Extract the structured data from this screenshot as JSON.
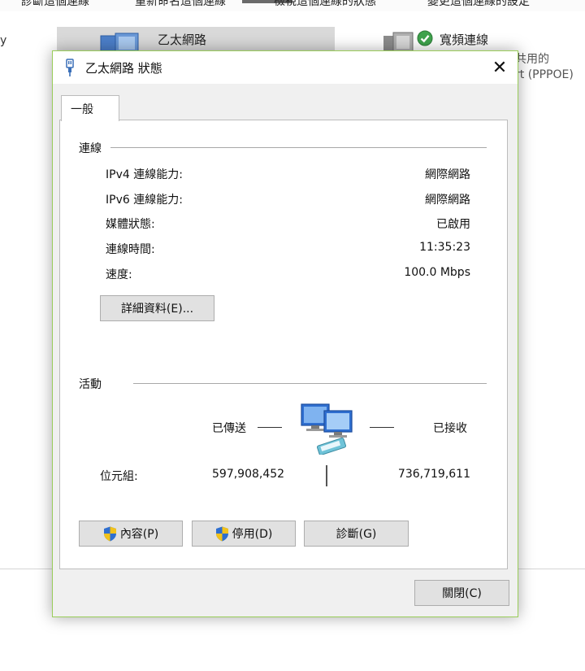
{
  "background": {
    "toolbar_items": [
      "診斷這個連線",
      "重新命名這個連線",
      "檢視這個連線的狀態",
      "變更這個連線的設定"
    ],
    "left_char": "y",
    "items": [
      {
        "name": "乙太網路",
        "selected": true
      },
      {
        "name": "寬頻連線",
        "subtitle_1": "共用的",
        "subtitle_2": "rt (PPPOE)"
      }
    ]
  },
  "dialog": {
    "title": "乙太網路 狀態",
    "close_glyph": "✕",
    "tab_label": "一般",
    "connection": {
      "group_label": "連線",
      "rows": [
        {
          "label": "IPv4 連線能力:",
          "value": "網際網路"
        },
        {
          "label": "IPv6 連線能力:",
          "value": "網際網路"
        },
        {
          "label": "媒體狀態:",
          "value": "已啟用"
        },
        {
          "label": "連線時間:",
          "value": "11:35:23"
        },
        {
          "label": "速度:",
          "value": "100.0 Mbps"
        }
      ],
      "details_button": "詳細資料(E)..."
    },
    "activity": {
      "group_label": "活動",
      "sent_label": "已傳送",
      "received_label": "已接收",
      "bytes_label": "位元組:",
      "bytes_sent": "597,908,452",
      "bytes_received": "736,719,611"
    },
    "buttons": {
      "properties": "內容(P)",
      "disable": "停用(D)",
      "diagnose": "診斷(G)"
    },
    "close_button": "關閉(C)"
  },
  "colors": {
    "dialog_border": "#9acd5a",
    "button_face": "#e1e1e1",
    "panel_bg": "#ffffff",
    "dialog_bg": "#f0f0f0",
    "shield_blue": "#2f6fd0",
    "shield_gold": "#f2c21b"
  }
}
